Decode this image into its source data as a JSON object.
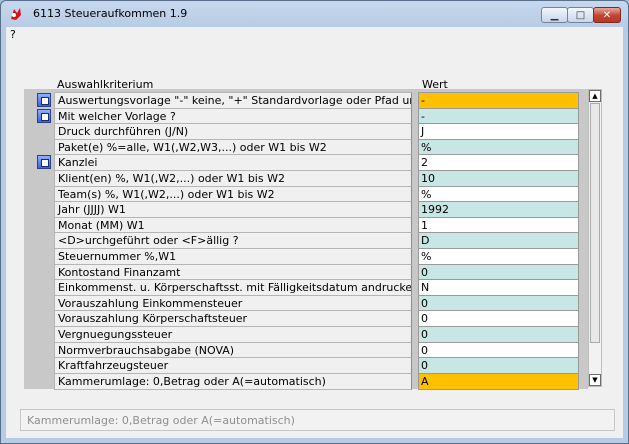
{
  "window": {
    "title": "6113 Steueraufkommen 1.9"
  },
  "menu": {
    "help": "?"
  },
  "columns": {
    "criterion": "Auswahlkriterium",
    "value": "Wert"
  },
  "colors": {
    "yellow": "#ffc000",
    "cyan": "#c8e6e4",
    "white": "#ffffff"
  },
  "rows": [
    {
      "label": "Auswertungsvorlage \"-\" keine, \"+\" Standardvorlage oder Pfad und Dateiname",
      "value": "-",
      "button": true,
      "bg": "yellow"
    },
    {
      "label": "Mit welcher Vorlage ?",
      "value": "-",
      "button": true,
      "bg": "cyan"
    },
    {
      "label": "Druck durchführen (J/N)",
      "value": "J",
      "button": false,
      "bg": "white"
    },
    {
      "label": "Paket(e) %=alle, W1(,W2,W3,...) oder W1 bis W2",
      "value": "%",
      "button": false,
      "bg": "cyan"
    },
    {
      "label": "Kanzlei",
      "value": "2",
      "button": true,
      "bg": "white"
    },
    {
      "label": "Klient(en)  %, W1(,W2,...) oder W1 bis W2",
      "value": "10",
      "button": false,
      "bg": "cyan"
    },
    {
      "label": "Team(s)  %, W1(,W2,...) oder W1 bis W2",
      "value": "%",
      "button": false,
      "bg": "white"
    },
    {
      "label": "Jahr (JJJJ)   W1",
      "value": "1992",
      "button": false,
      "bg": "cyan"
    },
    {
      "label": "Monat (MM)    W1",
      "value": "1",
      "button": false,
      "bg": "white"
    },
    {
      "label": "<D>urchgeführt oder <F>ällig ?",
      "value": "D",
      "button": false,
      "bg": "cyan"
    },
    {
      "label": "Steuernummer  %,W1",
      "value": "%",
      "button": false,
      "bg": "white"
    },
    {
      "label": "Kontostand Finanzamt",
      "value": "0",
      "button": false,
      "bg": "cyan"
    },
    {
      "label": "Einkommenst. u. Körperschaftsst. mit Fälligkeitsdatum andrucken? (J/N)",
      "value": "N",
      "button": false,
      "bg": "white"
    },
    {
      "label": "Vorauszahlung Einkommensteuer",
      "value": "0",
      "button": false,
      "bg": "cyan"
    },
    {
      "label": "Vorauszahlung Körperschaftsteuer",
      "value": "0",
      "button": false,
      "bg": "white"
    },
    {
      "label": "Vergnuegungssteuer",
      "value": "0",
      "button": false,
      "bg": "cyan"
    },
    {
      "label": "Normverbrauchsabgabe (NOVA)",
      "value": "0",
      "button": false,
      "bg": "white"
    },
    {
      "label": "Kraftfahrzeugsteuer",
      "value": "0",
      "button": false,
      "bg": "cyan"
    },
    {
      "label": "Kammerumlage: 0,Betrag oder A(=automatisch)",
      "value": "A",
      "button": false,
      "bg": "yellow"
    }
  ],
  "status": {
    "text": "Kammerumlage: 0,Betrag oder A(=automatisch)"
  }
}
